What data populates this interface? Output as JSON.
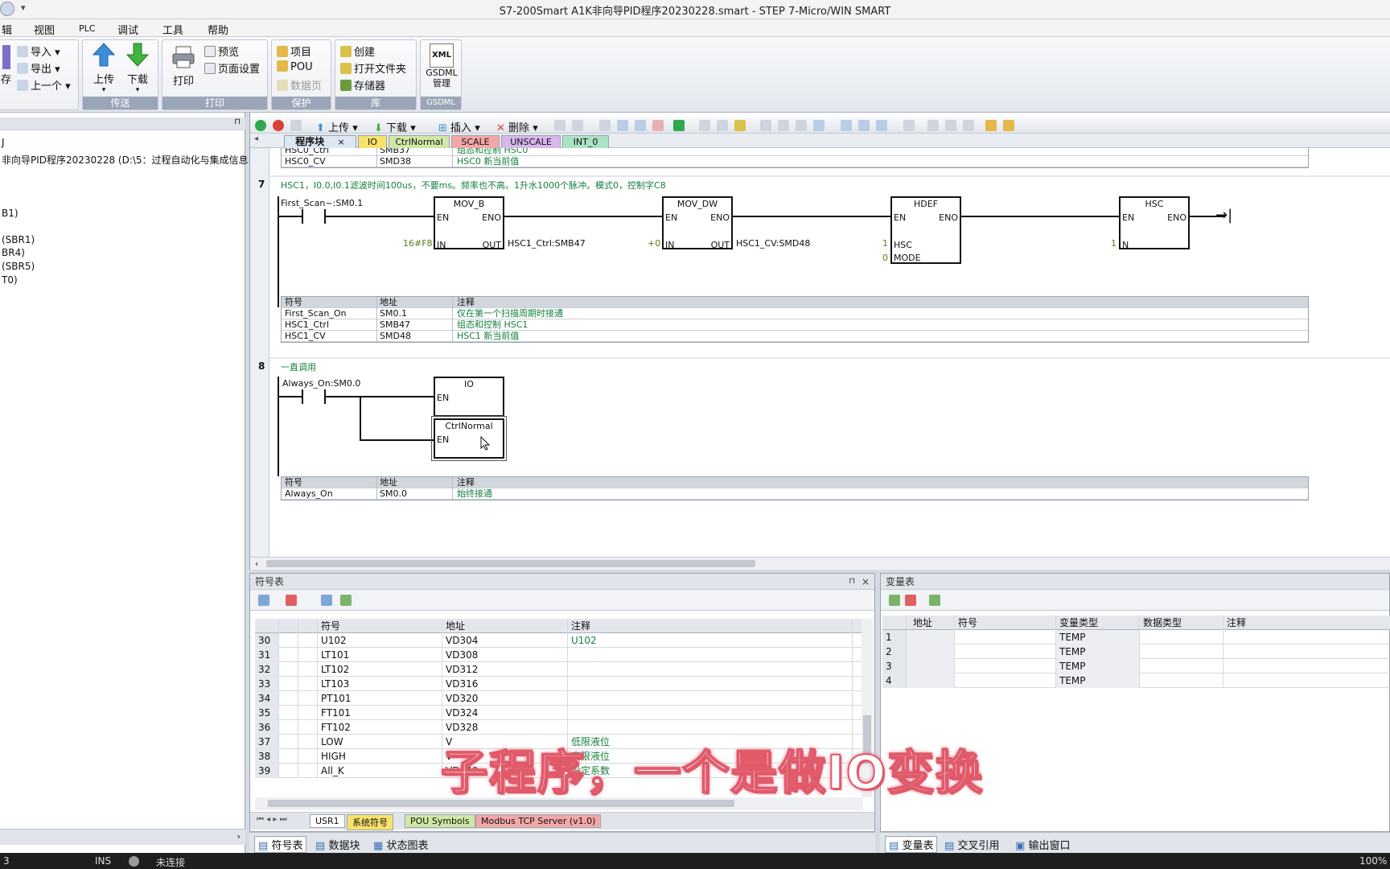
{
  "title_bar": {
    "title": "S7-200Smart A1K非向导PID程序20230228.smart - STEP 7-Micro/WIN SMART"
  },
  "menu": [
    "辑",
    "视图",
    "PLC",
    "调试",
    "工具",
    "帮助"
  ],
  "ribbon": {
    "group_transfer": {
      "import": "导入",
      "export": "导出",
      "up_one": "上一个",
      "save_partial": "存",
      "upload": "上传",
      "download": "下载",
      "label": "传送"
    },
    "group_print": {
      "print": "打印",
      "preview": "预览",
      "page_setup": "页面设置",
      "label": "打印"
    },
    "group_protect": {
      "project": "项目",
      "pou": "POU",
      "data_page": "数据页",
      "label": "保护"
    },
    "group_library": {
      "create": "创建",
      "open_folder": "打开文件夹",
      "memory": "存储器",
      "label": "库"
    },
    "group_gsdml": {
      "icon_text": "XML",
      "manage": "GSDML\n管理",
      "label": "GSDML"
    }
  },
  "project_tree": {
    "lines": [
      "J",
      "非向导PID程序20230228 (D:\\5：过程自动化与集成信息系",
      "B1)",
      "(SBR1)",
      "BR4)",
      "(SBR5)",
      "T0)"
    ]
  },
  "editor_toolbar": {
    "upload": "上传",
    "download": "下载",
    "insert": "插入",
    "delete": "删除"
  },
  "editor_tabs": [
    {
      "label": "程序块",
      "color": "#dde6f3"
    },
    {
      "label": "IO",
      "color": "#f7e26b"
    },
    {
      "label": "CtrlNormal",
      "color": "#cfe8a6"
    },
    {
      "label": "SCALE",
      "color": "#f4a7a7"
    },
    {
      "label": "UNSCALE",
      "color": "#d7b6ea"
    },
    {
      "label": "INT_0",
      "color": "#a9e3c4"
    }
  ],
  "top_partial_table": [
    {
      "sym": "HSC0_Ctrl",
      "addr": "SMB37",
      "comment": "组态和控制 HSC0"
    },
    {
      "sym": "HSC0_CV",
      "addr": "SMD38",
      "comment": "HSC0 新当前值"
    }
  ],
  "rung7": {
    "number": "7",
    "comment": "HSC1，I0.0,I0.1滤波时间100us，不要ms。频率也不高。1升水1000个脉冲。模式0，控制字C8",
    "contact": "First_Scan~:SM0.1",
    "mov_b": {
      "title": "MOV_B",
      "en": "EN",
      "eno": "ENO",
      "in": "IN",
      "out": "OUT",
      "in_val": "16#F8",
      "out_val": "HSC1_Ctrl:SMB47"
    },
    "mov_dw": {
      "title": "MOV_DW",
      "en": "EN",
      "eno": "ENO",
      "in": "IN",
      "out": "OUT",
      "in_val": "+0",
      "out_val": "HSC1_CV:SMD48"
    },
    "hdef": {
      "title": "HDEF",
      "en": "EN",
      "eno": "ENO",
      "hsc": "HSC",
      "mode": "MODE",
      "hsc_val": "1",
      "mode_val": "0"
    },
    "hsc": {
      "title": "HSC",
      "en": "EN",
      "eno": "ENO",
      "n": "N",
      "n_val": "1"
    },
    "table": {
      "headers": [
        "符号",
        "地址",
        "注释"
      ],
      "rows": [
        {
          "sym": "First_Scan_On",
          "addr": "SM0.1",
          "comment": "仅在第一个扫描周期时接通"
        },
        {
          "sym": "HSC1_Ctrl",
          "addr": "SMB47",
          "comment": "组态和控制 HSC1"
        },
        {
          "sym": "HSC1_CV",
          "addr": "SMD48",
          "comment": "HSC1 新当前值"
        }
      ]
    }
  },
  "rung8": {
    "number": "8",
    "comment": "一直调用",
    "contact": "Always_On:SM0.0",
    "io": {
      "title": "IO",
      "en": "EN"
    },
    "ctrl": {
      "title": "CtrlNormal",
      "en": "EN"
    },
    "table": {
      "headers": [
        "符号",
        "地址",
        "注释"
      ],
      "rows": [
        {
          "sym": "Always_On",
          "addr": "SM0.0",
          "comment": "始终接通"
        }
      ]
    }
  },
  "symbol_table": {
    "title": "符号表",
    "headers": [
      "符号",
      "地址",
      "注释"
    ],
    "rows": [
      {
        "n": "30",
        "sym": "U102",
        "addr": "VD304",
        "comment": "U102"
      },
      {
        "n": "31",
        "sym": "LT101",
        "addr": "VD308",
        "comment": ""
      },
      {
        "n": "32",
        "sym": "LT102",
        "addr": "VD312",
        "comment": ""
      },
      {
        "n": "33",
        "sym": "LT103",
        "addr": "VD316",
        "comment": ""
      },
      {
        "n": "34",
        "sym": "PT101",
        "addr": "VD320",
        "comment": ""
      },
      {
        "n": "35",
        "sym": "FT101",
        "addr": "VD324",
        "comment": ""
      },
      {
        "n": "36",
        "sym": "FT102",
        "addr": "VD328",
        "comment": ""
      },
      {
        "n": "37",
        "sym": "LOW",
        "addr": "V",
        "comment": "低限液位"
      },
      {
        "n": "38",
        "sym": "HIGH",
        "addr": "V",
        "comment": "高限液位"
      },
      {
        "n": "39",
        "sym": "All_K",
        "addr": "VD340",
        "comment": "设定系数"
      }
    ],
    "tabs": [
      "USR1",
      "系统符号",
      "POU Symbols",
      "Modbus TCP Server (v1.0)"
    ]
  },
  "var_table": {
    "title": "变量表",
    "headers": [
      "地址",
      "符号",
      "变量类型",
      "数据类型",
      "注释"
    ],
    "rows": [
      {
        "n": "1",
        "type": "TEMP"
      },
      {
        "n": "2",
        "type": "TEMP"
      },
      {
        "n": "3",
        "type": "TEMP"
      },
      {
        "n": "4",
        "type": "TEMP"
      }
    ]
  },
  "bottom_tabs_left": [
    "符号表",
    "数据块",
    "状态图表"
  ],
  "bottom_tabs_right": [
    "变量表",
    "交叉引用",
    "输出窗口"
  ],
  "subtitle": "子程序，一个是做IO变换",
  "status_bar": {
    "row": "3",
    "mode": "INS",
    "connection": "未连接",
    "zoom": "100%"
  }
}
